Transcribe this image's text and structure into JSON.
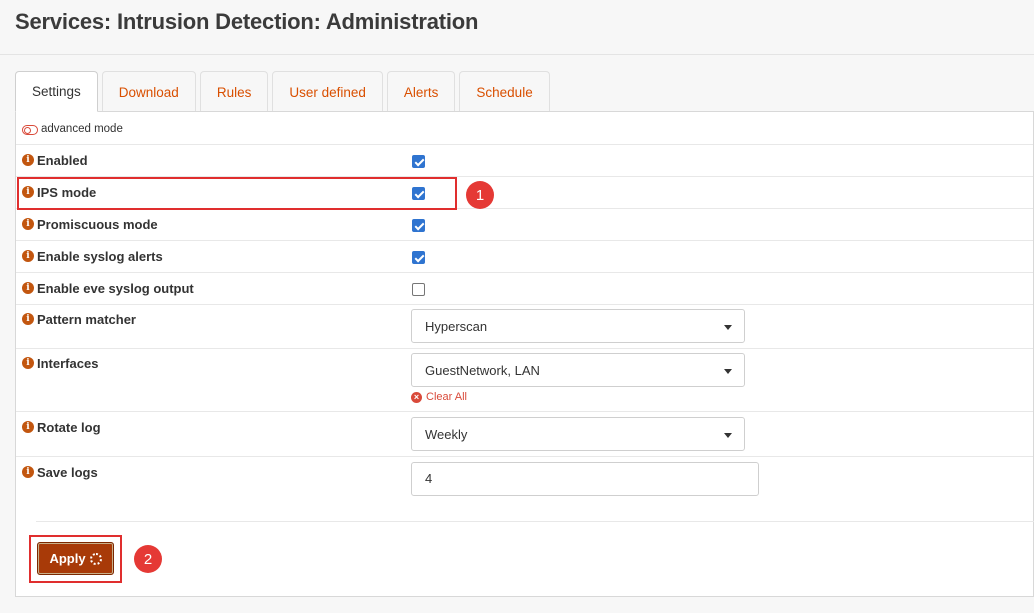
{
  "page_title": "Services: Intrusion Detection: Administration",
  "tabs": [
    {
      "label": "Settings",
      "active": true
    },
    {
      "label": "Download",
      "active": false
    },
    {
      "label": "Rules",
      "active": false
    },
    {
      "label": "User defined",
      "active": false
    },
    {
      "label": "Alerts",
      "active": false
    },
    {
      "label": "Schedule",
      "active": false
    }
  ],
  "advanced_mode": {
    "label": "advanced mode",
    "icon": "toggle-icon"
  },
  "settings": {
    "enabled": {
      "label": "Enabled",
      "checked": true
    },
    "ips_mode": {
      "label": "IPS mode",
      "checked": true
    },
    "promiscuous_mode": {
      "label": "Promiscuous mode",
      "checked": true
    },
    "syslog_alerts": {
      "label": "Enable syslog alerts",
      "checked": true
    },
    "eve_syslog": {
      "label": "Enable eve syslog output",
      "checked": false
    },
    "pattern_matcher": {
      "label": "Pattern matcher",
      "value": "Hyperscan"
    },
    "interfaces": {
      "label": "Interfaces",
      "value": "GuestNetwork, LAN",
      "clear_label": "Clear All"
    },
    "rotate_log": {
      "label": "Rotate log",
      "value": "Weekly"
    },
    "save_logs": {
      "label": "Save logs",
      "value": "4"
    }
  },
  "apply_label": "Apply",
  "info_icon_glyph": "i",
  "annotations": {
    "marker_1": "1",
    "marker_2": "2"
  },
  "colors": {
    "accent": "#d94f00",
    "button": "#a83a08",
    "annotation": "#e53935"
  }
}
